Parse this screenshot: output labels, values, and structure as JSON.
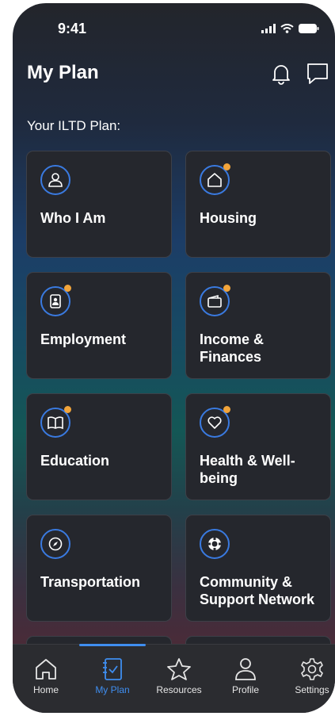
{
  "status": {
    "time": "9:41",
    "signal_icon": "signal-icon",
    "wifi_icon": "wifi-icon",
    "battery_icon": "battery-icon"
  },
  "header": {
    "title": "My Plan",
    "bell_icon": "bell-icon",
    "chat_icon": "chat-icon"
  },
  "subtitle": "Your ILTD Plan:",
  "accent": "#3f8ef0",
  "notification_dot_color": "#f1a43b",
  "cards": [
    {
      "label": "Who I Am",
      "icon": "person-icon",
      "notification": false
    },
    {
      "label": "Housing",
      "icon": "house-icon",
      "notification": true
    },
    {
      "label": "Employment",
      "icon": "badge-icon",
      "notification": true
    },
    {
      "label": "Income & Finances",
      "icon": "wallet-icon",
      "notification": true
    },
    {
      "label": "Education",
      "icon": "book-icon",
      "notification": true
    },
    {
      "label": "Health & Well-being",
      "icon": "heart-icon",
      "notification": true
    },
    {
      "label": "Transportation",
      "icon": "compass-icon",
      "notification": false
    },
    {
      "label": "Community & Support Network",
      "icon": "lifebuoy-icon",
      "notification": false
    }
  ],
  "tabs": [
    {
      "label": "Home",
      "icon": "home-icon",
      "active": false
    },
    {
      "label": "My Plan",
      "icon": "plan-icon",
      "active": true
    },
    {
      "label": "Resources",
      "icon": "star-icon",
      "active": false
    },
    {
      "label": "Profile",
      "icon": "profile-icon",
      "active": false
    },
    {
      "label": "Settings",
      "icon": "gear-icon",
      "active": false
    }
  ]
}
